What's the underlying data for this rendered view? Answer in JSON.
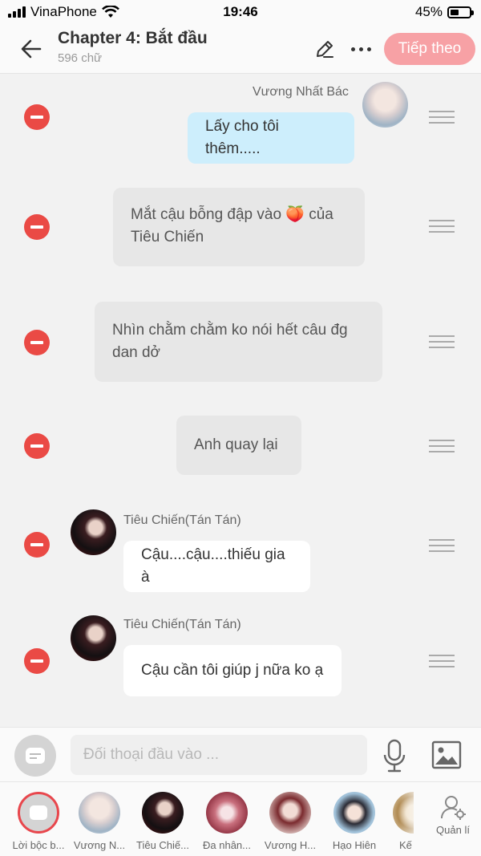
{
  "status_bar": {
    "carrier": "VinaPhone",
    "time": "19:46",
    "battery": "45%",
    "battery_level": 0.45
  },
  "header": {
    "title": "Chapter 4: Bắt đầu",
    "word_count": "596 chữ",
    "next_label": "Tiếp theo",
    "accent_color": "#f7a1a5"
  },
  "messages": [
    {
      "type": "mine",
      "speaker": "Vương Nhất Bác",
      "text": "Lấy cho tôi thêm....."
    },
    {
      "type": "narration",
      "text_line1": "Mắt cậu bỗng đập vào 🍑 của",
      "text_line2": "Tiêu Chiến"
    },
    {
      "type": "narration",
      "text_line1": "Nhìn chằm chằm ko nói hết câu đg",
      "text_line2": "dan dở"
    },
    {
      "type": "narration",
      "text": "Anh quay lại"
    },
    {
      "type": "theirs",
      "speaker": "Tiêu Chiến(Tán Tán)",
      "text": "Cậu....cậu....thiếu gia à"
    },
    {
      "type": "theirs",
      "speaker": "Tiêu Chiến(Tán Tán)",
      "text": "Cậu cần tôi giúp j nữa ko ạ"
    }
  ],
  "input": {
    "placeholder": "Đối thoại đầu vào ..."
  },
  "characters": [
    {
      "label": "Lời bộc b..."
    },
    {
      "label": "Vương N..."
    },
    {
      "label": "Tiêu Chiế..."
    },
    {
      "label": "Đa nhân..."
    },
    {
      "label": "Vương H..."
    },
    {
      "label": "Hạo Hiên"
    },
    {
      "label": "Kế"
    }
  ],
  "manage_label": "Quản lí",
  "colors": {
    "remove": "#ea4a45",
    "mine_bubble": "#cdeefc",
    "narration_bubble": "#e7e7e7",
    "theirs_bubble": "#ffffff"
  }
}
